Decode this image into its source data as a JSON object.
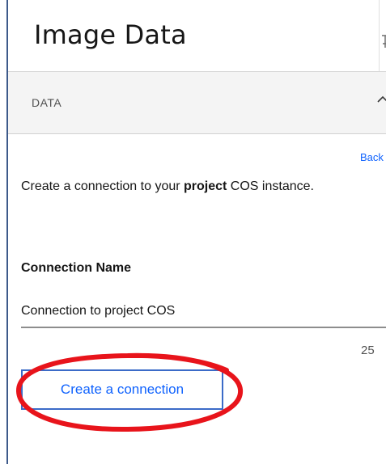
{
  "header": {
    "title": "Image Data"
  },
  "section": {
    "label": "DATA"
  },
  "back_link": "Back",
  "description": {
    "before": "Create a connection to your ",
    "bold": "project",
    "after": " COS instance."
  },
  "connection_name": {
    "label": "Connection Name",
    "value": "Connection to project COS",
    "char_count": "25"
  },
  "create_button_label": "Create a connection",
  "colors": {
    "link": "#0f62fe",
    "annotation": "#e8141b"
  }
}
